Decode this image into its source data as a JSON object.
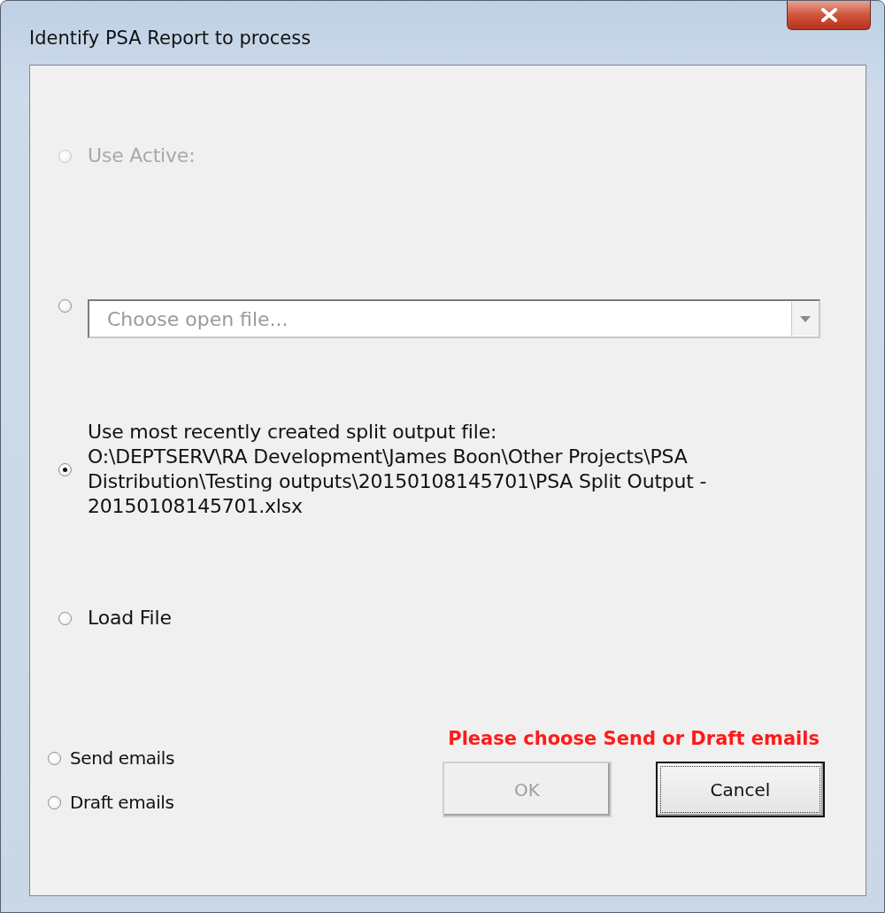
{
  "window": {
    "title": "Identify PSA Report to process"
  },
  "sources": [
    {
      "kind": "label",
      "label": "Use Active:",
      "selected": false,
      "disabled": true
    },
    {
      "kind": "combo",
      "placeholder": "Choose open file...",
      "selected": false,
      "disabled": false
    },
    {
      "kind": "label",
      "label": "Use most recently created split output file:\nO:\\DEPTSERV\\RA Development\\James Boon\\Other Projects\\PSA\nDistribution\\Testing outputs\\20150108145701\\PSA Split Output -\n20150108145701.xlsx",
      "selected": true,
      "disabled": false
    },
    {
      "kind": "label",
      "label": "Load File",
      "selected": false,
      "disabled": false
    }
  ],
  "email_modes": [
    {
      "label": "Send emails",
      "selected": false
    },
    {
      "label": "Draft emails",
      "selected": false
    }
  ],
  "warning": "Please choose Send or Draft emails",
  "buttons": [
    {
      "label": "OK",
      "disabled": true,
      "focused": false
    },
    {
      "label": "Cancel",
      "disabled": false,
      "focused": true
    }
  ]
}
